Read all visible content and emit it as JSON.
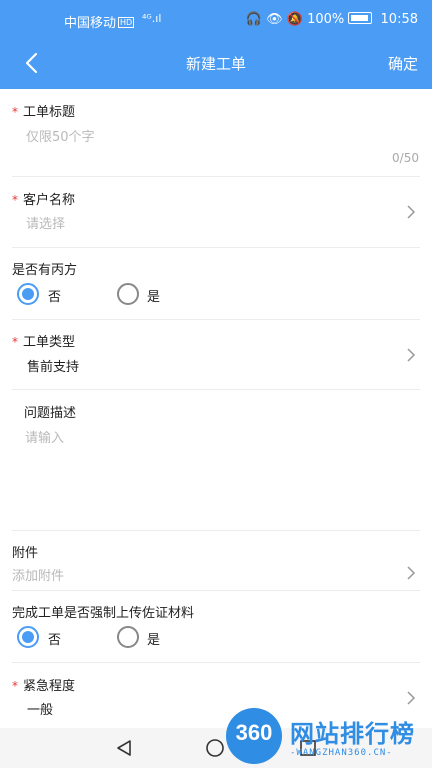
{
  "status_bar": {
    "carrier": "中国移动",
    "hd": "HD",
    "signal": "⁴ᴳ.ıl",
    "battery": "100%",
    "time": "10:58"
  },
  "nav": {
    "title": "新建工单",
    "confirm": "确定"
  },
  "form": {
    "ticket_title": {
      "label": "工单标题",
      "placeholder": "仅限50个字",
      "counter": "0/50",
      "required_mark": "*"
    },
    "customer": {
      "label": "客户名称",
      "placeholder": "请选择",
      "required_mark": "*"
    },
    "third_party": {
      "label": "是否有丙方",
      "options": [
        "否",
        "是"
      ],
      "selected": "否"
    },
    "ticket_type": {
      "label": "工单类型",
      "value": "售前支持",
      "required_mark": "*"
    },
    "description": {
      "label": "问题描述",
      "placeholder": "请输入"
    },
    "attachment": {
      "label": "附件",
      "placeholder": "添加附件"
    },
    "force_upload": {
      "label": "完成工单是否强制上传佐证材料",
      "options": [
        "否",
        "是"
      ],
      "selected": "否"
    },
    "urgency": {
      "label": "紧急程度",
      "value": "一般",
      "required_mark": "*"
    }
  },
  "watermark": {
    "badge": "360",
    "name": "网站排行榜",
    "domain": "-WANGZHAN360.CN-"
  },
  "colors": {
    "primary": "#4a9cf5",
    "required": "#e53935",
    "placeholder": "#b9b9b9"
  }
}
